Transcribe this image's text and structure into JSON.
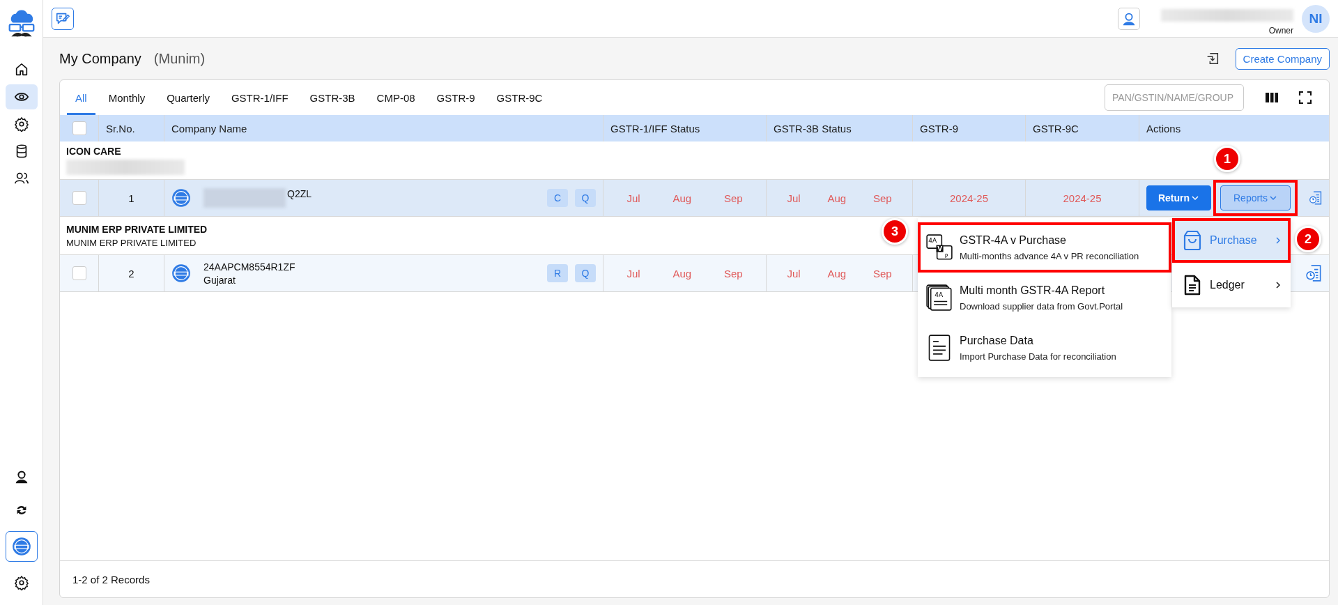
{
  "sidebar": {
    "top": [
      {
        "kind": "home",
        "selected": false
      },
      {
        "kind": "eye",
        "selected": true
      },
      {
        "kind": "gear",
        "selected": false
      },
      {
        "kind": "database",
        "selected": false
      },
      {
        "kind": "users",
        "selected": false
      }
    ],
    "bottom": [
      {
        "kind": "agent",
        "selected": false
      },
      {
        "kind": "sync",
        "selected": false
      },
      {
        "kind": "gst",
        "selected": true
      },
      {
        "kind": "gear",
        "selected": false
      }
    ]
  },
  "header": {
    "initials": "NI",
    "role": "Owner"
  },
  "page": {
    "title": "My Company",
    "subtitle": "(Munim)",
    "create_button": "Create Company"
  },
  "tabs": [
    {
      "label": "All",
      "selected": true
    },
    {
      "label": "Monthly",
      "selected": false
    },
    {
      "label": "Quarterly",
      "selected": false
    },
    {
      "label": "GSTR-1/IFF",
      "selected": false
    },
    {
      "label": "GSTR-3B",
      "selected": false
    },
    {
      "label": "CMP-08",
      "selected": false
    },
    {
      "label": "GSTR-9",
      "selected": false
    },
    {
      "label": "GSTR-9C",
      "selected": false
    }
  ],
  "search": {
    "placeholder": "PAN/GSTIN/NAME/GROUP"
  },
  "table": {
    "all_checked": false,
    "columns": [
      "Sr.No.",
      "Company Name",
      "GSTR-1/IFF Status",
      "GSTR-3B Status",
      "GSTR-9",
      "GSTR-9C",
      "Actions"
    ],
    "groups": [
      {
        "name": "ICON CARE",
        "rows": [
          {
            "selected": true,
            "checked": false,
            "sr": "1",
            "gstin": "Q2ZL",
            "redacted": true,
            "tags": [
              "C",
              "Q"
            ],
            "gstr1": [
              "Jul",
              "Aug",
              "Sep"
            ],
            "gstr3b": [
              "Jul",
              "Aug",
              "Sep"
            ],
            "gstr9": "2024-25",
            "gstr9c": "2024-25",
            "actions": [
              {
                "label": "Return",
                "kind": "primary",
                "highlighted": false
              },
              {
                "label": "Reports",
                "kind": "secondary",
                "highlighted": true
              }
            ]
          }
        ]
      },
      {
        "name": "MUNIM ERP PRIVATE LIMITED",
        "subtitle": "MUNIM ERP PRIVATE LIMITED",
        "rows": [
          {
            "selected": false,
            "checked": false,
            "sr": "2",
            "gstin": "24AAPCM8554R1ZF",
            "state": "Gujarat",
            "redacted": false,
            "tags": [
              "R",
              "Q"
            ],
            "gstr1": [
              "Jul",
              "Aug",
              "Sep"
            ],
            "gstr3b": [
              "Jul",
              "Aug",
              "Sep"
            ],
            "actions": []
          }
        ]
      }
    ]
  },
  "menu": {
    "items": [
      {
        "kind": "compare",
        "highlighted": true,
        "icon_text": [
          "4A",
          "V",
          "P"
        ],
        "title": "GSTR-4A v Purchase",
        "description": "Multi-months advance 4A v PR reconciliation"
      },
      {
        "kind": "stack",
        "highlighted": false,
        "icon_text": [
          "4A"
        ],
        "title": "Multi month GSTR-4A Report",
        "description": "Download supplier data from Govt.Portal"
      },
      {
        "kind": "sheet",
        "highlighted": false,
        "title": "Purchase Data",
        "description": "Import Purchase Data for reconciliation"
      }
    ]
  },
  "submenu": {
    "items": [
      {
        "kind": "bag",
        "label": "Purchase",
        "selected": true,
        "highlighted": true
      },
      {
        "kind": "doc",
        "label": "Ledger",
        "selected": false,
        "highlighted": false
      }
    ]
  },
  "callouts": [
    "1",
    "2",
    "3"
  ],
  "footer": {
    "records": "1-2 of 2 Records"
  }
}
